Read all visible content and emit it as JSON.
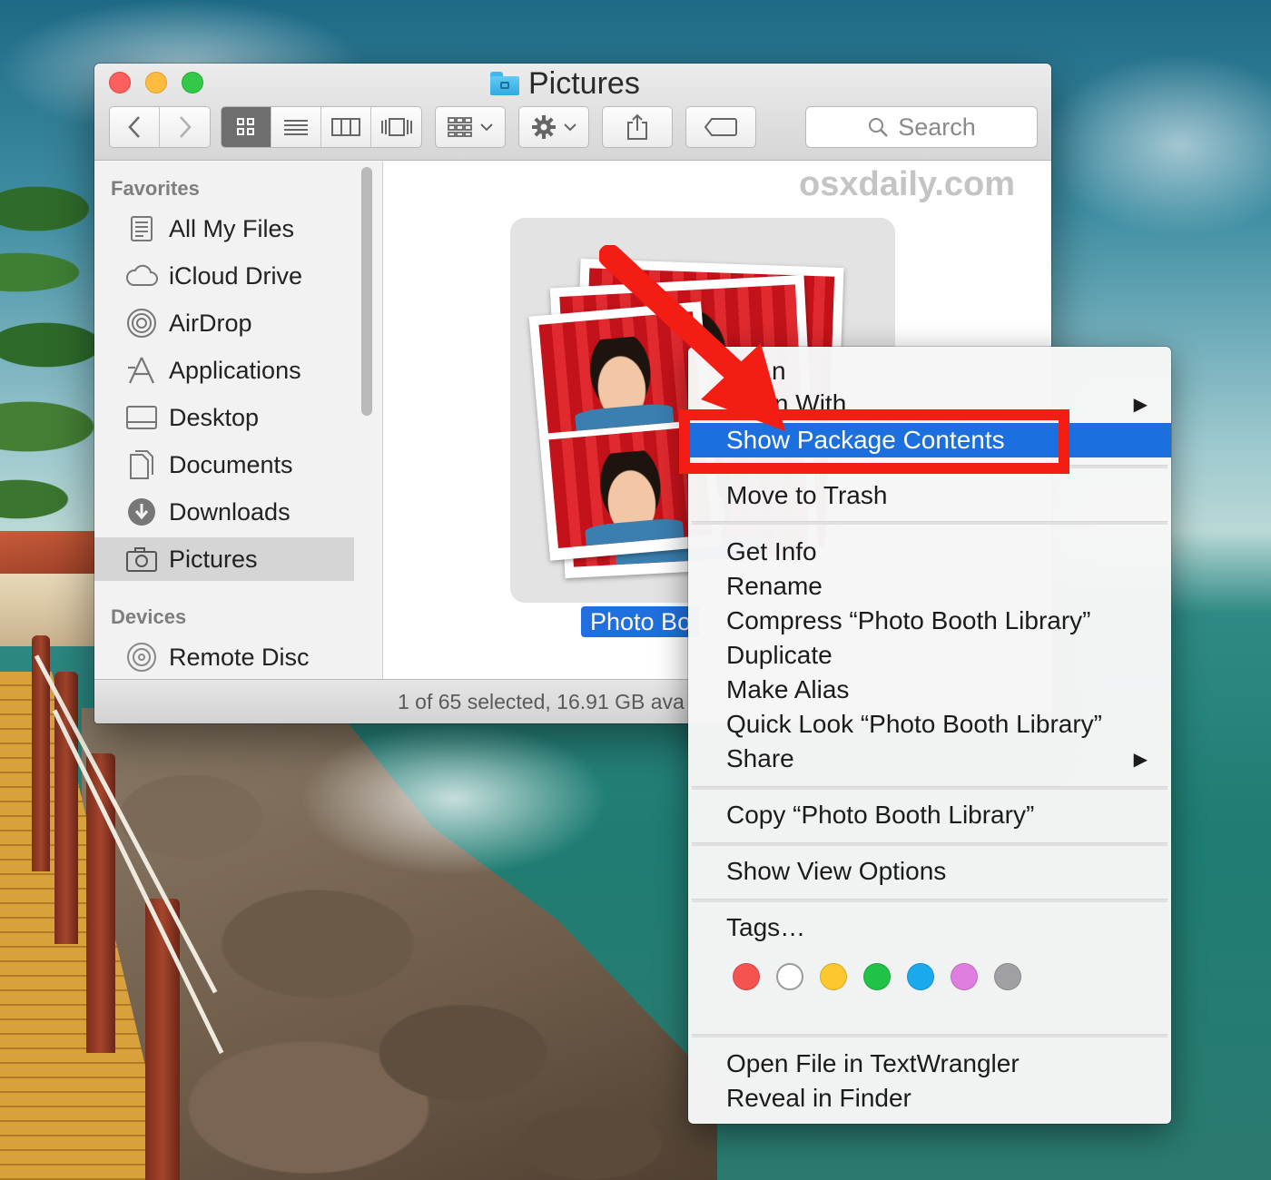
{
  "window": {
    "title": "Pictures",
    "watermark": "osxdaily.com"
  },
  "toolbar": {
    "search_label": "Search",
    "view_modes": [
      "icon",
      "list",
      "column",
      "cover-flow"
    ],
    "active_view": "icon"
  },
  "sidebar": {
    "favorites_header": "Favorites",
    "favorites": [
      {
        "label": "All My Files",
        "icon": "all-files-icon"
      },
      {
        "label": "iCloud Drive",
        "icon": "cloud-icon"
      },
      {
        "label": "AirDrop",
        "icon": "airdrop-icon"
      },
      {
        "label": "Applications",
        "icon": "applications-icon"
      },
      {
        "label": "Desktop",
        "icon": "desktop-icon"
      },
      {
        "label": "Documents",
        "icon": "documents-icon"
      },
      {
        "label": "Downloads",
        "icon": "downloads-icon"
      },
      {
        "label": "Pictures",
        "icon": "camera-icon",
        "selected": true
      }
    ],
    "devices_header": "Devices",
    "devices": [
      {
        "label": "Remote Disc",
        "icon": "disc-icon"
      }
    ]
  },
  "content": {
    "selected_item_label": "Photo Bo"
  },
  "statusbar": {
    "text": "1 of 65 selected, 16.91 GB ava"
  },
  "context_menu": {
    "items": {
      "open": "n",
      "open_with": "Open With",
      "show_package_contents": "Show Package Contents",
      "move_to_trash": "Move to Trash",
      "get_info": "Get Info",
      "rename": "Rename",
      "compress": "Compress “Photo Booth Library”",
      "duplicate": "Duplicate",
      "make_alias": "Make Alias",
      "quick_look": "Quick Look “Photo Booth Library”",
      "share": "Share",
      "copy": "Copy “Photo Booth Library”",
      "show_view_options": "Show View Options",
      "tags": "Tags…",
      "open_in_textwrangler": "Open File in TextWrangler",
      "reveal_in_finder": "Reveal in Finder"
    },
    "highlighted": "show_package_contents",
    "tag_colors": [
      "#f4534f",
      "#ffffff",
      "#fbc82f",
      "#20c345",
      "#1ba9ee",
      "#e07ee0",
      "#a0a0a4"
    ]
  },
  "colors": {
    "selection_blue": "#1b6fde",
    "annotation_red": "#f41d14"
  }
}
